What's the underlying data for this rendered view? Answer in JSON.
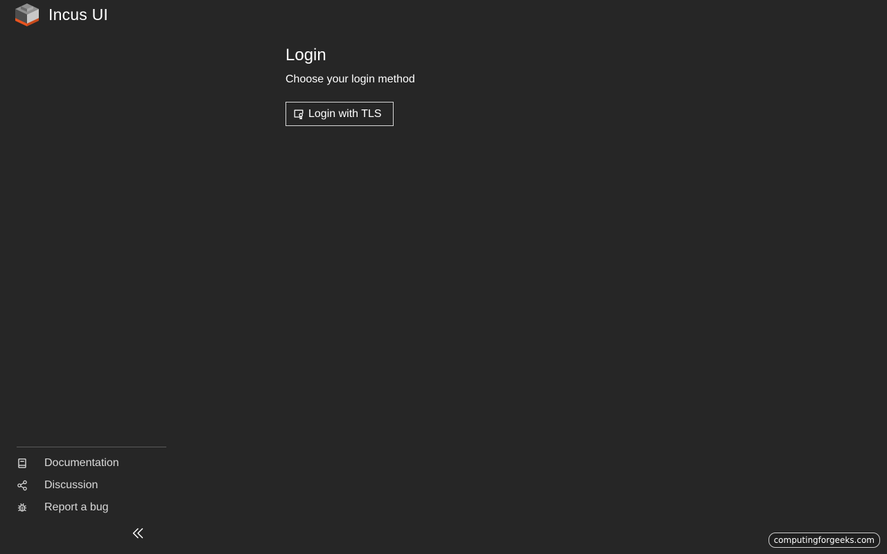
{
  "app": {
    "title": "Incus UI",
    "logo_icon": "incus-cube-logo",
    "brand_colors": {
      "cube_top": "#8f8f8f",
      "cube_side_dark": "#4d4d4d",
      "cube_side_light": "#c8c8c8",
      "cube_base": "#e95420"
    }
  },
  "login": {
    "title": "Login",
    "subtitle": "Choose your login method",
    "tls_button_label": "Login with TLS",
    "tls_button_icon": "certificate-icon"
  },
  "sidebar": {
    "links": [
      {
        "label": "Documentation",
        "icon": "book-icon"
      },
      {
        "label": "Discussion",
        "icon": "share-icon"
      },
      {
        "label": "Report a bug",
        "icon": "bug-icon"
      }
    ],
    "collapse_icon": "double-chevron-left-icon"
  },
  "watermark": {
    "text": "computingforgeeks.com"
  },
  "colors": {
    "background": "#262626",
    "text": "#ffffff",
    "muted_text": "#d9d9d9",
    "divider": "#5a5a5a",
    "button_border": "#d9d9d9"
  }
}
